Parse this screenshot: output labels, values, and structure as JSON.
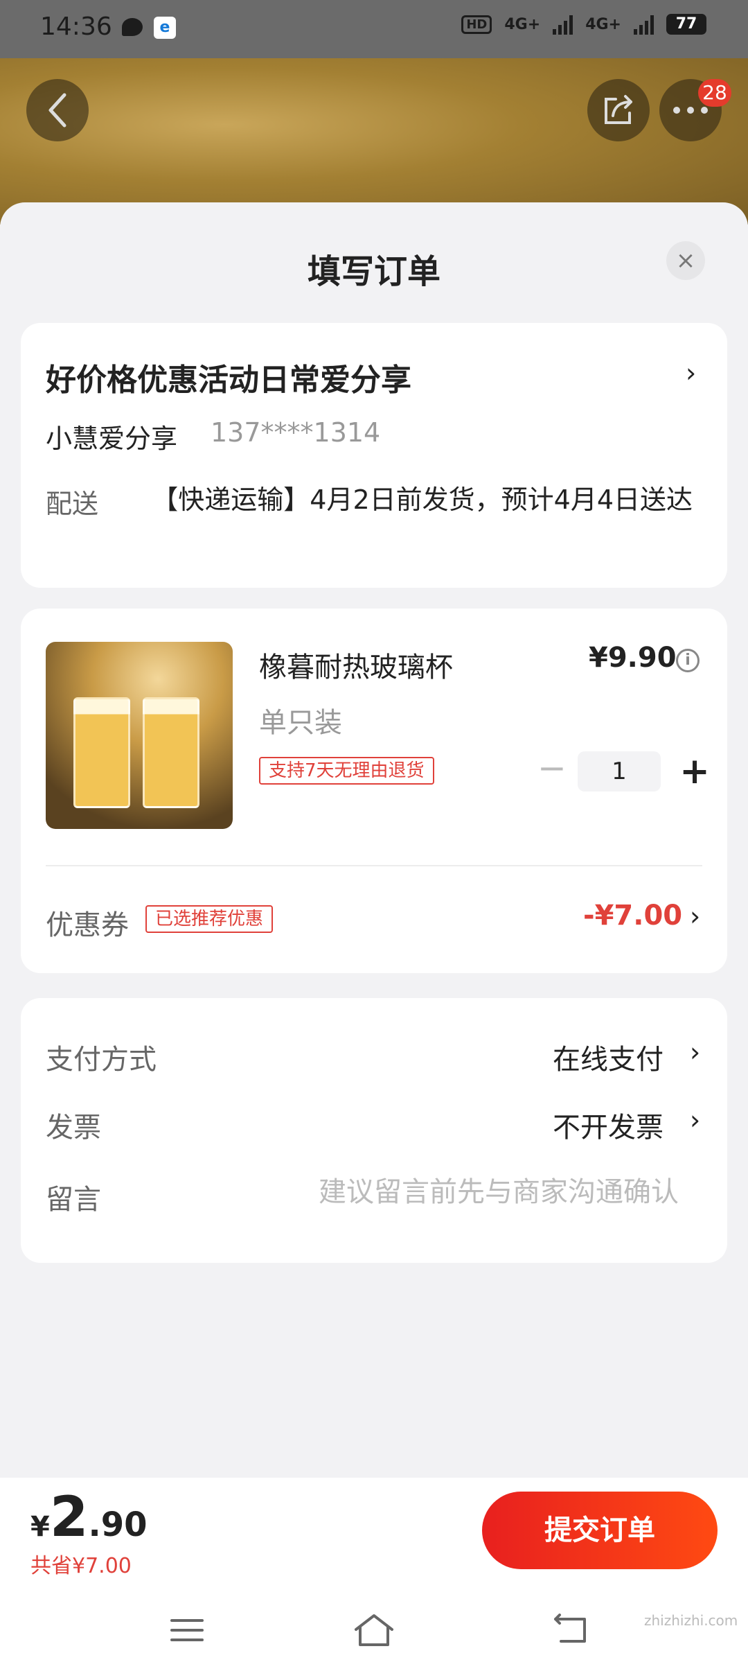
{
  "status_bar": {
    "time": "14:36",
    "hd": "HD",
    "network_1": "4G+",
    "network_2": "4G+",
    "battery": "77"
  },
  "header": {
    "notification_count": "28"
  },
  "sheet": {
    "title": "填写订单",
    "close": "×"
  },
  "address": {
    "title": "好价格优惠活动日常爱分享",
    "name": "小慧爱分享",
    "phone": "137****1314"
  },
  "shipping": {
    "label": "配送",
    "text": "【快递运输】4月2日前发货，预计4月4日送达"
  },
  "product": {
    "name": "橡暮耐热玻璃杯",
    "price": "¥9.90",
    "spec": "单只装",
    "return_tag": "支持7天无理由退货",
    "quantity": "1",
    "minus": "−",
    "plus": "+"
  },
  "coupon": {
    "label": "优惠券",
    "tag": "已选推荐优惠",
    "amount": "-¥7.00"
  },
  "payment": {
    "label": "支付方式",
    "value": "在线支付"
  },
  "invoice": {
    "label": "发票",
    "value": "不开发票"
  },
  "message": {
    "label": "留言",
    "placeholder": "建议留言前先与商家沟通确认"
  },
  "bottom": {
    "currency": "¥",
    "total_int": "2",
    "total_dec": ".90",
    "saved": "共省¥7.00",
    "submit": "提交订单"
  },
  "watermark": "zhizhizhi.com",
  "colors": {
    "accent_red": "#e0413a",
    "submit_gradient_start": "#e8201f",
    "submit_gradient_end": "#ff4a12"
  }
}
